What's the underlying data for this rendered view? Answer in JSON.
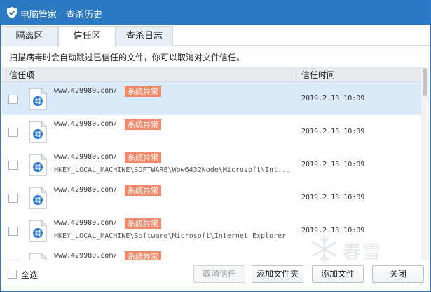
{
  "window": {
    "title": "电脑管家 - 查杀历史"
  },
  "tabs": [
    {
      "label": "隔离区",
      "active": false
    },
    {
      "label": "信任区",
      "active": true
    },
    {
      "label": "查杀日志",
      "active": false
    }
  ],
  "hint": "扫描病毒时会自动跳过已信任的文件，你可以取消对文件信任。",
  "list": {
    "columns": {
      "item": "信任项",
      "time": "信任时间"
    },
    "rows": [
      {
        "url": "www.429980.com/",
        "badge": "系统异常",
        "path": "",
        "time": "2019.2.18 10:09",
        "selected": true
      },
      {
        "url": "www.429980.com/",
        "badge": "系统异常",
        "path": "",
        "time": "2019.2.18 10:09",
        "selected": false
      },
      {
        "url": "www.429980.com/",
        "badge": "系统异常",
        "path": "HKEY_LOCAL_MACHINE\\SOFTWARE\\Wow6432Node\\Microsoft\\Int...",
        "time": "2019.2.18 10:09",
        "selected": false
      },
      {
        "url": "www.429980.com/",
        "badge": "系统异常",
        "path": "",
        "time": "2019.2.18 10:09",
        "selected": false
      },
      {
        "url": "www.429980.com/",
        "badge": "系统异常",
        "path": "HKEY_LOCAL_MACHINE\\Software\\Microsoft\\Internet Explorer",
        "time": "2019.2.18 10:09",
        "selected": false
      },
      {
        "url": "www.429980.com/",
        "badge": "系统异常",
        "path": "",
        "time": "",
        "selected": false
      }
    ]
  },
  "footer": {
    "select_all": "全选",
    "buttons": {
      "untrust": "取消信任",
      "add_folder": "添加文件夹",
      "add_file": "添加文件",
      "close": "关闭"
    }
  },
  "watermark": "春雪",
  "colors": {
    "titlebar": "#2b79c2",
    "badge": "#f08a6a",
    "selected_row": "#dbeaf9"
  }
}
